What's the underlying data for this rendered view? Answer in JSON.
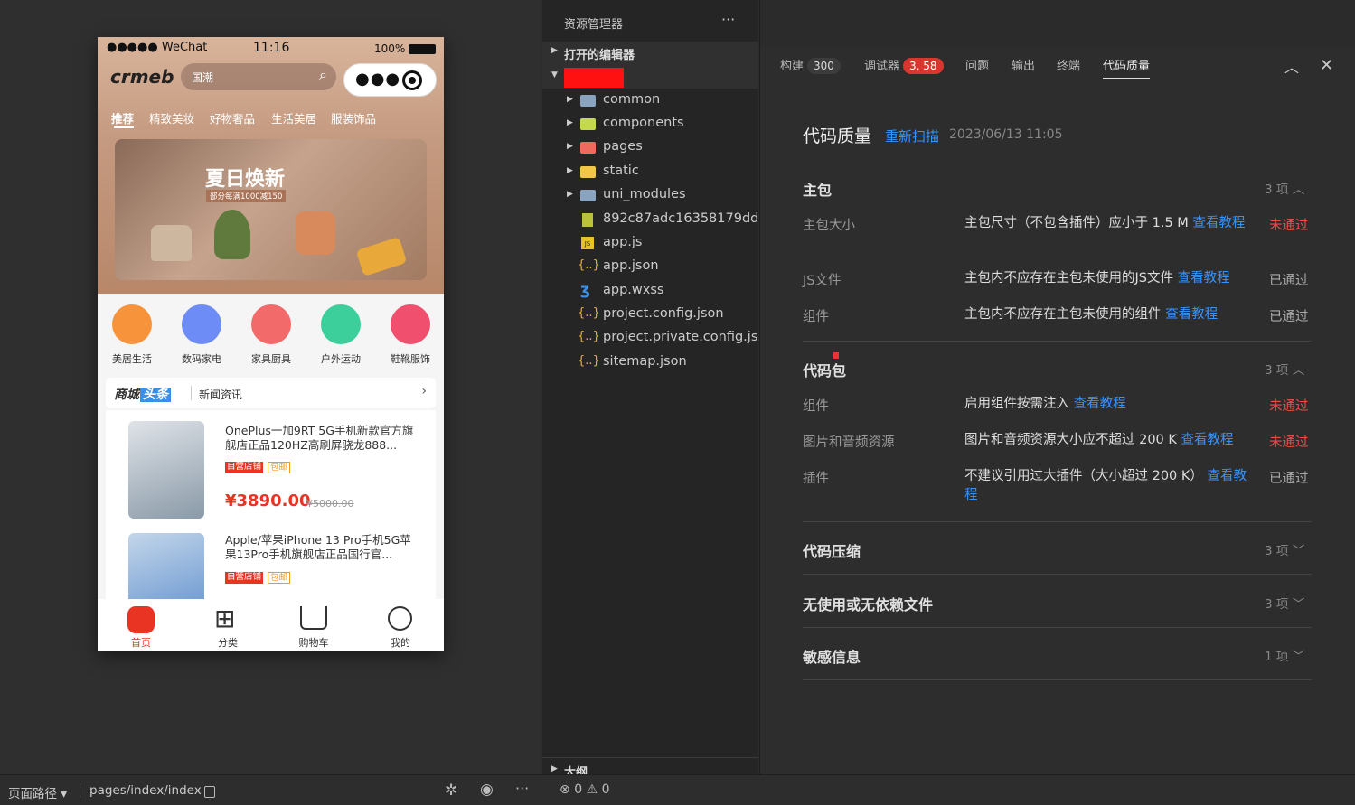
{
  "simulator": {
    "status": {
      "carrier": "WeChat",
      "time": "11:16",
      "battery": "100%"
    },
    "logo": "crmeb",
    "search_placeholder": "国潮",
    "categories": [
      "推荐",
      "精致美妆",
      "好物奢品",
      "生活美居",
      "服装饰品"
    ],
    "banner": {
      "title": "夏日焕新",
      "subtitle": "部分每满1000减150"
    },
    "quick_icons": [
      {
        "label": "美居生活",
        "color": "#f7943b",
        "icon": "suitcase-icon"
      },
      {
        "label": "数码家电",
        "color": "#6d8cf5",
        "icon": "phone-icon"
      },
      {
        "label": "家具厨具",
        "color": "#f36a6a",
        "icon": "sofa-icon"
      },
      {
        "label": "户外运动",
        "color": "#3ccf9c",
        "icon": "badminton-icon"
      },
      {
        "label": "鞋靴服饰",
        "color": "#f0506e",
        "icon": "dress-icon"
      }
    ],
    "news": {
      "brand_a": "商城",
      "brand_b": "头条",
      "text": "新闻资讯"
    },
    "products": [
      {
        "title": "OnePlus一加9RT 5G手机新款官方旗舰店正品120HZ高刷屏骁龙888...",
        "tag1": "自营店铺",
        "tag2": "包邮",
        "price": "¥3890.00",
        "old_price": "¥5000.00"
      },
      {
        "title": "Apple/苹果iPhone 13 Pro手机5G苹果13Pro手机旗舰店正品国行官...",
        "tag1": "自营店铺",
        "tag2": "包邮"
      }
    ],
    "tabbar": [
      {
        "label": "首页",
        "icon": "home-icon",
        "active": true
      },
      {
        "label": "分类",
        "icon": "grid-icon"
      },
      {
        "label": "购物车",
        "icon": "cart-icon"
      },
      {
        "label": "我的",
        "icon": "user-icon"
      }
    ]
  },
  "explorer": {
    "title": "资源管理器",
    "more": "···",
    "open_editors": "打开的编辑器",
    "outline": "大纲",
    "files": [
      {
        "name": "common",
        "type": "folder",
        "icon": "folder-icon",
        "color": "#8aa4c0"
      },
      {
        "name": "components",
        "type": "folder",
        "icon": "folder-components-icon",
        "color": "#c5d94e"
      },
      {
        "name": "pages",
        "type": "folder",
        "icon": "folder-pages-icon",
        "color": "#ef6b5b"
      },
      {
        "name": "static",
        "type": "folder",
        "icon": "folder-static-icon",
        "color": "#f3c64a"
      },
      {
        "name": "uni_modules",
        "type": "folder",
        "icon": "folder-icon",
        "color": "#8aa4c0"
      },
      {
        "name": "892c87adc16358179dd...",
        "type": "file",
        "icon": "zip-icon",
        "color": "#b9c23a"
      },
      {
        "name": "app.js",
        "type": "file",
        "icon": "js-icon",
        "color": "#e6c229"
      },
      {
        "name": "app.json",
        "type": "file",
        "icon": "json-icon",
        "color": "#e6b422"
      },
      {
        "name": "app.wxss",
        "type": "file",
        "icon": "css-icon",
        "color": "#3c8fe6"
      },
      {
        "name": "project.config.json",
        "type": "file",
        "icon": "json-icon",
        "color": "#e6b422"
      },
      {
        "name": "project.private.config.js...",
        "type": "file",
        "icon": "json-icon",
        "color": "#e6b422"
      },
      {
        "name": "sitemap.json",
        "type": "file",
        "icon": "json-icon",
        "color": "#e6b422"
      }
    ]
  },
  "panel": {
    "tabs": [
      {
        "label": "构建",
        "badge": "300",
        "badge_color": "#3c3c3c"
      },
      {
        "label": "调试器",
        "badge": "3, 58",
        "badge_color": "#d9362f"
      },
      {
        "label": "问题"
      },
      {
        "label": "输出"
      },
      {
        "label": "终端"
      },
      {
        "label": "代码质量",
        "active": true
      }
    ],
    "heading": "代码质量",
    "rescan": "重新扫描",
    "timestamp": "2023/06/13 11:05",
    "sections": [
      {
        "title": "主包",
        "count": "3 项",
        "rows": [
          {
            "key": "主包大小",
            "value": "主包尺寸（不包含插件）应小于 1.5 M",
            "link": "查看教程",
            "status": "未通过",
            "ok": false
          },
          {
            "key": "JS文件",
            "value": "主包内不应存在主包未使用的JS文件",
            "link": "查看教程",
            "status": "已通过",
            "ok": true
          },
          {
            "key": "组件",
            "value": "主包内不应存在主包未使用的组件",
            "link": "查看教程",
            "status": "已通过",
            "ok": true
          }
        ]
      },
      {
        "title": "代码包",
        "count": "3 项",
        "rows": [
          {
            "key": "组件",
            "value": "启用组件按需注入",
            "link": "查看教程",
            "status": "未通过",
            "ok": false
          },
          {
            "key": "图片和音频资源",
            "value": "图片和音频资源大小应不超过 200 K",
            "link": "查看教程",
            "status": "未通过",
            "ok": false
          },
          {
            "key": "插件",
            "value": "不建议引用过大插件（大小超过 200 K）",
            "link": "查看教程",
            "status": "已通过",
            "ok": true
          }
        ]
      },
      {
        "title": "代码压缩",
        "count": "3 项"
      },
      {
        "title": "无使用或无依赖文件",
        "count": "3 项"
      },
      {
        "title": "敏感信息",
        "count": "1 项"
      }
    ]
  },
  "statusbar": {
    "path_label": "页面路径",
    "path": "pages/index/index",
    "errors": "0",
    "warnings": "0"
  }
}
